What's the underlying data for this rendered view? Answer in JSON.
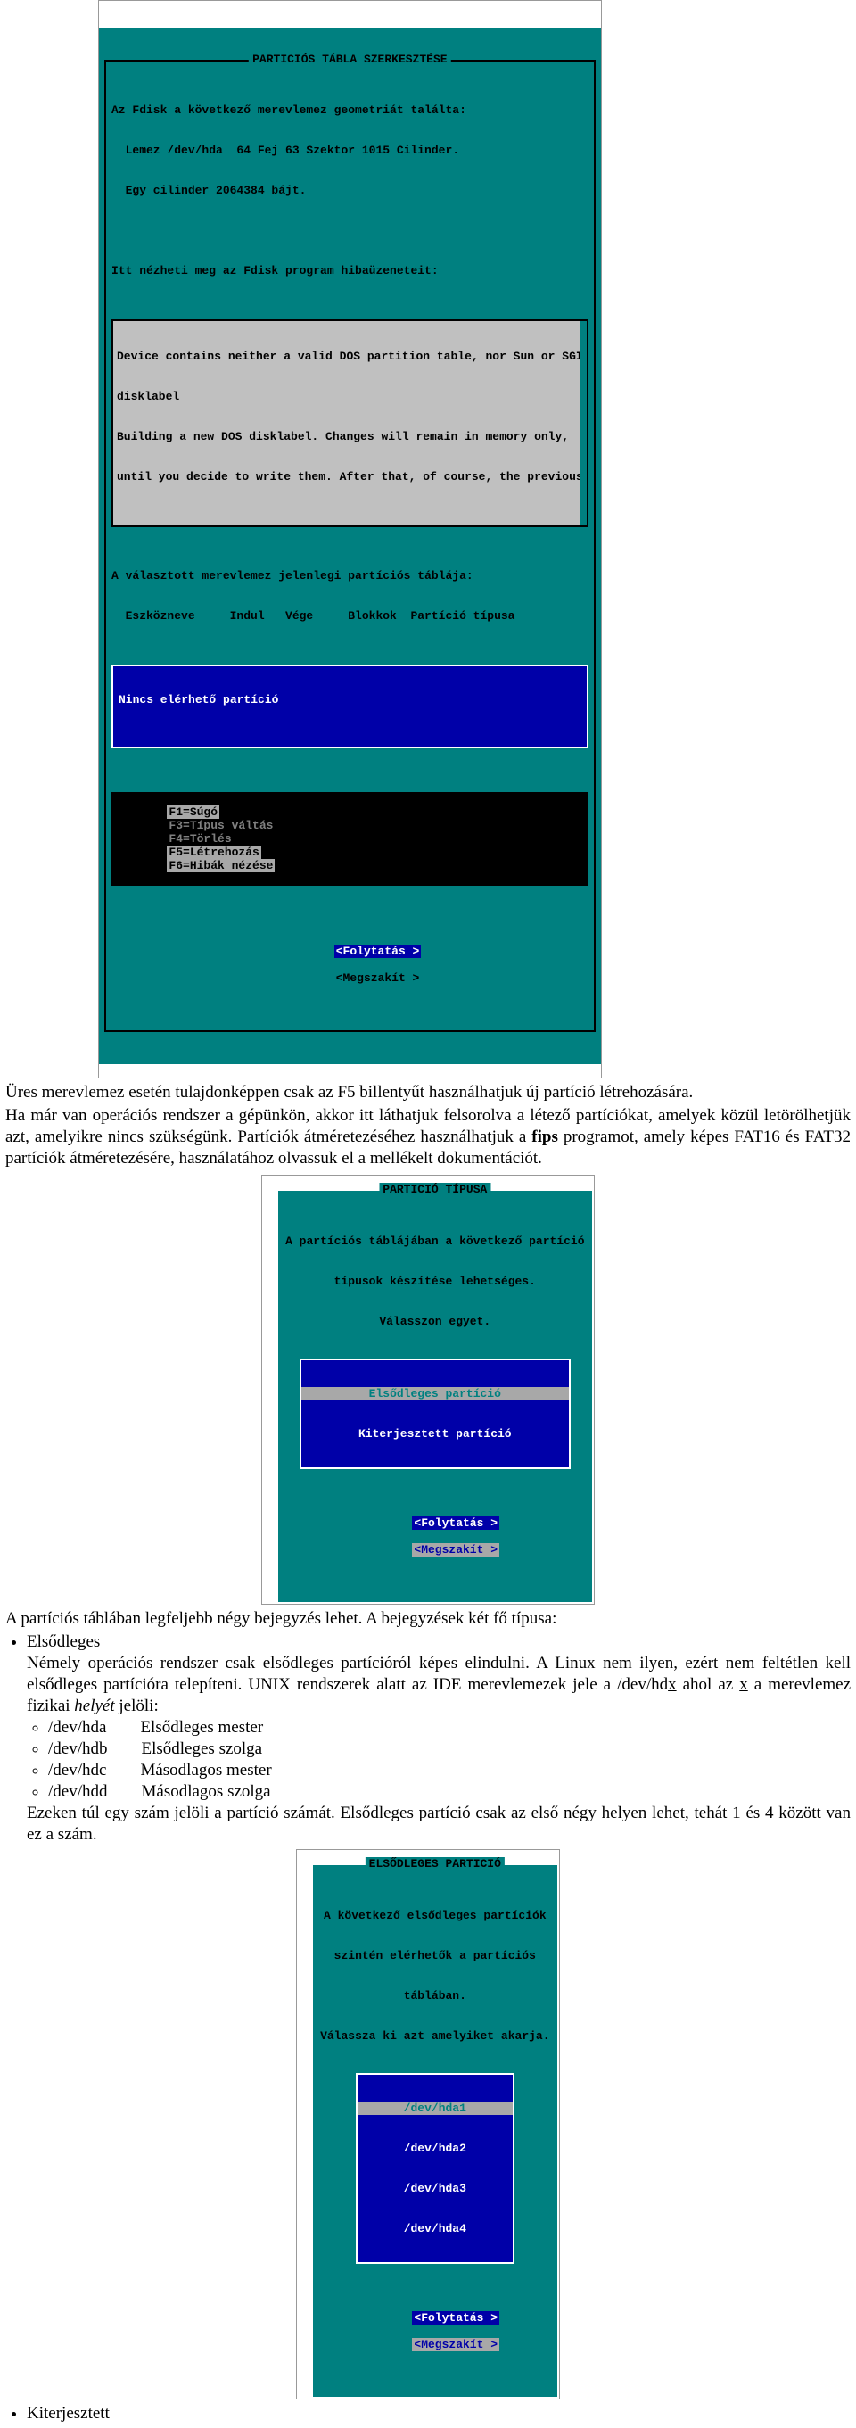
{
  "screen1": {
    "title": "PARTICIÓS TÁBLA SZERKESZTÉSE",
    "lines": [
      "Az Fdisk a következő merevlemez geometriát találta:",
      "  Lemez /dev/hda  64 Fej 63 Szektor 1015 Cilinder.",
      "  Egy cilinder 2064384 bájt.",
      " ",
      "Itt nézheti meg az Fdisk program hibaüzeneteit:"
    ],
    "msgbox": [
      "Device contains neither a valid DOS partition table, nor Sun or SGI",
      "disklabel",
      "Building a new DOS disklabel. Changes will remain in memory only,",
      "until you decide to write them. After that, of course, the previous"
    ],
    "tabhdr1": "A választott merevlemez jelenlegi partíciós táblája:",
    "tabhdr2": "  Eszközneve     Indul   Vége     Blokkok  Partíció típusa",
    "listrow": "Nincs elérhető partíció",
    "fn": {
      "f1": "F1=Súgó",
      "f3": "F3=Típus váltás",
      "f4": "F4=Törlés",
      "f5": "F5=Létrehozás",
      "f6": "F6=Hibák nézése"
    },
    "btn1": "<Folytatás >",
    "btn2": "<Megszakít >"
  },
  "para1": "Üres merevlemez esetén tulajdonképpen csak az F5 billentyűt használhatjuk új partíció létrehozására.",
  "para2a": "Ha már van operációs rendszer a gépünkön, akkor itt láthatjuk felsorolva a létező partíciókat, amelyek közül letörölhetjük azt, amelyikre nincs szükségünk. Partíciók átméretezéséhez használhatjuk a ",
  "para2b": "fips",
  "para2c": " programot, amely képes FAT16 és FAT32 partíciók átméretezésére, használatához olvassuk el a mellékelt dokumentációt.",
  "screen2": {
    "title": "PARTICIÓ TÍPUSA",
    "l1": "A partíciós táblájában a következő partíció",
    "l2": "típusok készítése lehetséges.",
    "l3": "Válasszon egyet.",
    "opt1": "Elsődleges partíció",
    "opt2": "Kiterjesztett partíció",
    "btn1": "<Folytatás >",
    "btn2": "<Megszakít >"
  },
  "para3a": "A partíciós táblában legfeljebb négy bejegyzés lehet. A bejegyzések két fő típusa:",
  "li_elsod": "Elsődleges",
  "para4a": "Némely operációs rendszer csak elsődleges partícióról képes elindulni. A Linux nem ilyen, ezért nem feltétlen kell elsődleges partícióra telepíteni. UNIX rendszerek alatt az IDE merevlemezek jele a /dev/hd",
  "para4x": "x",
  "para4b": " ahol az ",
  "para4x2": "x",
  "para4c": " a merevlemez fizikai ",
  "para4hely": "helyét",
  "para4d": " jelöli:",
  "devs": [
    {
      "d": "/dev/hda",
      "t": "Elsődleges mester"
    },
    {
      "d": "/dev/hdb",
      "t": "Elsődleges szolga"
    },
    {
      "d": "/dev/hdc",
      "t": "Másodlagos mester"
    },
    {
      "d": "/dev/hdd",
      "t": "Másodlagos szolga"
    }
  ],
  "para5": "Ezeken túl egy szám jelöli a partíció számát. Elsődleges partíció csak az első négy helyen lehet, tehát 1 és 4 között van ez a szám.",
  "screen3": {
    "title": "ELSŐDLEGES PARTICIÓ",
    "l1": "A következő elsődleges partíciók",
    "l2": "szintén elérhetők a partíciós",
    "l3": "táblában.",
    "l4": "Válassza ki azt amelyiket akarja.",
    "opts": [
      "/dev/hda1",
      "/dev/hda2",
      "/dev/hda3",
      "/dev/hda4"
    ],
    "btn1": "<Folytatás >",
    "btn2": "<Megszakít >"
  },
  "li_kiterj": "Kiterjesztett"
}
